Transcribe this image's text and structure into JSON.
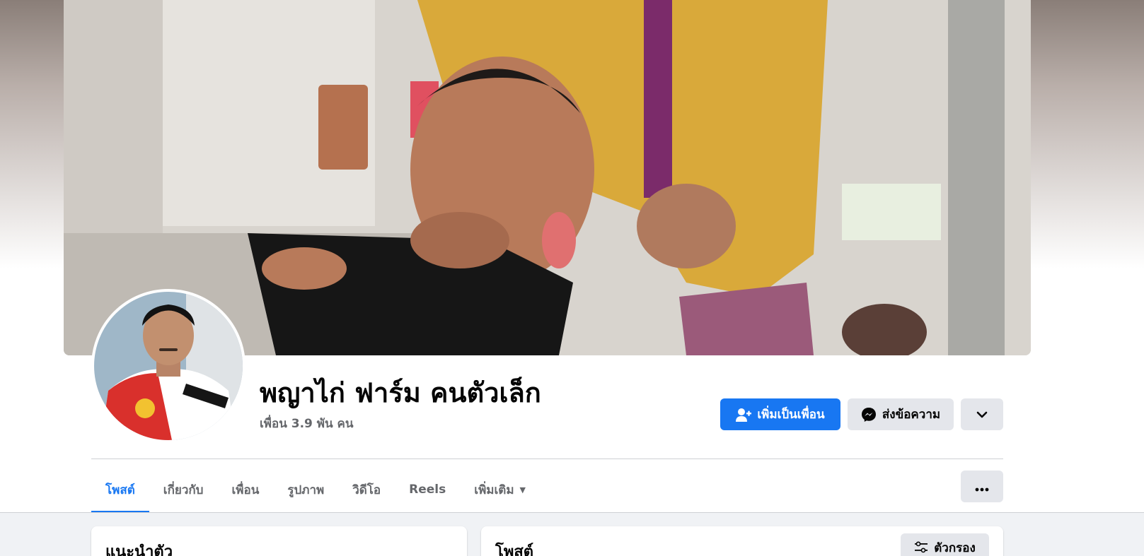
{
  "profile": {
    "name": "พญาไก่ ฟาร์ม คนตัวเล็ก",
    "friend_count": "เพื่อน 3.9 พัน คน"
  },
  "actions": {
    "add_friend_label": "เพิ่มเป็นเพื่อน",
    "message_label": "ส่งข้อความ"
  },
  "tabs": [
    {
      "label": "โพสต์",
      "active": true
    },
    {
      "label": "เกี่ยวกับ"
    },
    {
      "label": "เพื่อน"
    },
    {
      "label": "รูปภาพ"
    },
    {
      "label": "วิดีโอ"
    },
    {
      "label": "Reels"
    },
    {
      "label": "เพิ่มเติม"
    }
  ],
  "intro_card": {
    "title": "แนะนำตัว"
  },
  "posts_card": {
    "title": "โพสต์",
    "filter_label": "ตัวกรอง"
  },
  "colors": {
    "accent": "#1877f2",
    "background": "#f0f2f5",
    "secondary_button": "#e4e6eb"
  },
  "icons": [
    "add-friend-icon",
    "messenger-icon",
    "chevron-down-icon",
    "caret-down-icon",
    "ellipsis-icon",
    "filter-icon"
  ]
}
